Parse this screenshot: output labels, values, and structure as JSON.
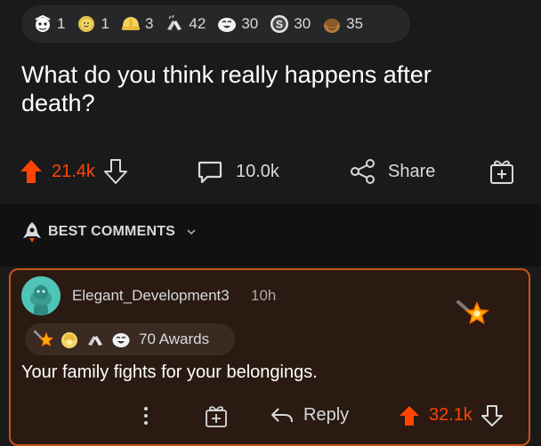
{
  "post": {
    "awards": [
      {
        "icon": "bird-face-award-icon",
        "count": "1"
      },
      {
        "icon": "sun-face-award-icon",
        "count": "1"
      },
      {
        "icon": "helmet-award-icon",
        "count": "3"
      },
      {
        "icon": "hands-award-icon",
        "count": "42"
      },
      {
        "icon": "laughing-face-award-icon",
        "count": "30"
      },
      {
        "icon": "silver-coin-award-icon",
        "count": "30"
      },
      {
        "icon": "bowing-face-award-icon",
        "count": "35"
      }
    ],
    "title": "What do you think really happens after death?",
    "upvotes": "21.4k",
    "comments": "10.0k",
    "share_label": "Share"
  },
  "sort": {
    "label": "BEST COMMENTS"
  },
  "comment": {
    "username": "Elegant_Development3",
    "age": "10h",
    "awards_label": "70 Awards",
    "award_icons": [
      "shooting-star-award-icon",
      "gold-helmet-award-icon",
      "hands-award-icon",
      "laughing-face-award-icon"
    ],
    "text": "Your family fights for your belongings.",
    "reply_label": "Reply",
    "upvotes": "32.1k"
  },
  "colors": {
    "background": "#1a1a1b",
    "upvote_orange": "#ff4500",
    "comment_border": "#c8541c"
  }
}
